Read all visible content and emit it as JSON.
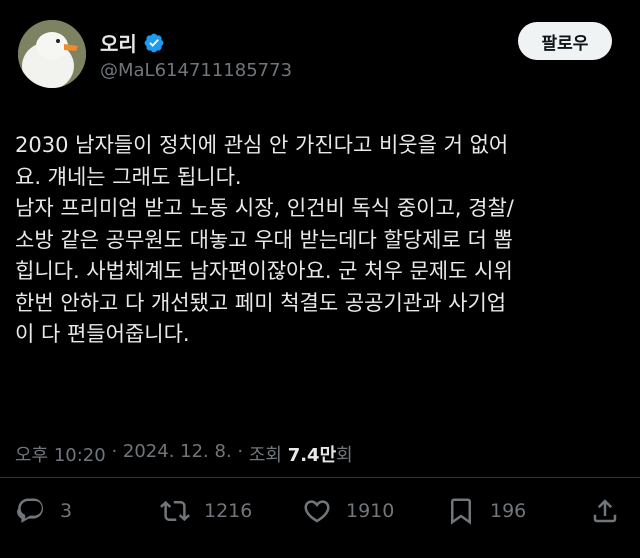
{
  "user": {
    "display_name": "오리",
    "handle": "@MaL614711185773",
    "verified": true,
    "avatar_icon": "duck-avatar-icon"
  },
  "follow_button": {
    "label": "팔로우"
  },
  "tweet": {
    "text": "2030 남자들이 정치에 관심 안 가진다고 비웃을 거 없어\n요. 걔네는 그래도 됩니다.\n남자 프리미엄 받고 노동 시장, 인건비 독식 중이고, 경찰/\n소방 같은 공무원도 대놓고 우대 받는데다 할당제로 더 뽑\n힙니다. 사법체계도 남자편이잖아요. 군 처우 문제도 시위\n한번 안하고 다 개선됐고 페미 척결도 공공기관과 사기업\n이 다 편들어줍니다."
  },
  "meta": {
    "time": "오후 10:20",
    "sep1": " · ",
    "date": "2024. 12. 8.",
    "sep2": " · ",
    "views_label": "조회 ",
    "views_count": "7.4만",
    "views_suffix": "회"
  },
  "actions": {
    "reply_count": "3",
    "retweet_count": "1216",
    "like_count": "1910",
    "bookmark_count": "196"
  },
  "colors": {
    "background": "#000000",
    "text": "#e7e9ea",
    "secondary": "#71767b",
    "verified": "#1d9bf0",
    "button_bg": "#eff3f4"
  }
}
